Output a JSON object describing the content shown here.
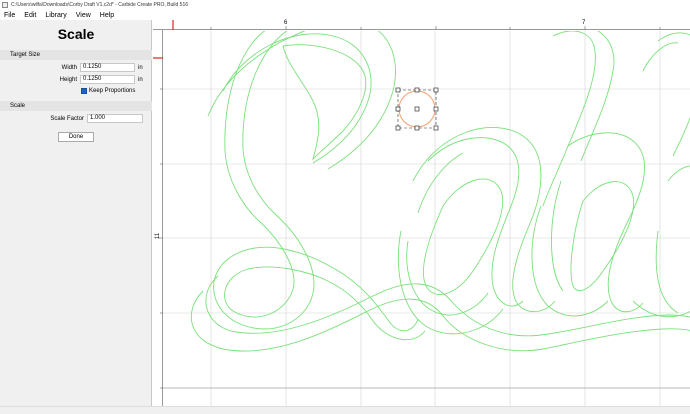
{
  "window": {
    "title": "C:\\Users\\wilfa\\Downloads\\Corby Draft V1.c2d* - Carbide Create PRO, Build 516"
  },
  "menu": {
    "items": [
      "File",
      "Edit",
      "Library",
      "View",
      "Help"
    ]
  },
  "panel": {
    "heading": "Scale",
    "target_size": {
      "section_label": "Target Size",
      "width_label": "Width",
      "width_value": "0.1250",
      "width_unit": "in",
      "height_label": "Height",
      "height_value": "0.1250",
      "height_unit": "in",
      "keep_proportions_label": "Keep Proportions",
      "keep_proportions_checked": true
    },
    "scale": {
      "section_label": "Scale",
      "factor_label": "Scale Factor",
      "factor_value": "1.000"
    },
    "done_label": "Done"
  },
  "rulers": {
    "top_labels": [
      "6",
      "7"
    ],
    "left_labels": [
      "11"
    ]
  },
  "colors": {
    "grid": "#d4d4d4",
    "vector_stroke": "#7be07b",
    "selection_circle": "#f0a070",
    "ruler_marker": "#e02020"
  }
}
